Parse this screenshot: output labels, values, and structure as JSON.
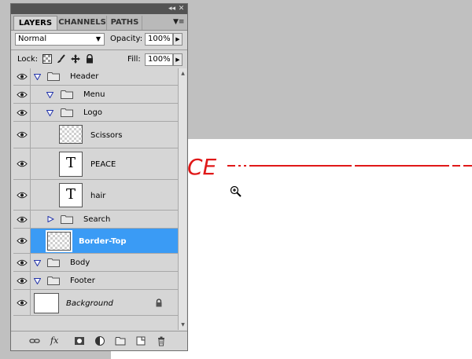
{
  "tabs": [
    {
      "label": "LAYERS",
      "active": true
    },
    {
      "label": "CHANNELS",
      "active": false
    },
    {
      "label": "PATHS",
      "active": false
    }
  ],
  "blend_mode": "Normal",
  "opacity": {
    "label": "Opacity:",
    "value": "100%"
  },
  "lock": {
    "label": "Lock:"
  },
  "fill": {
    "label": "Fill:",
    "value": "100%"
  },
  "layers": [
    {
      "name": "Header",
      "kind": "group",
      "expanded": true
    },
    {
      "name": "Menu",
      "kind": "group",
      "expanded": true
    },
    {
      "name": "Logo",
      "kind": "group",
      "expanded": true
    },
    {
      "name": "Scissors",
      "kind": "pixel"
    },
    {
      "name": "PEACE",
      "kind": "text"
    },
    {
      "name": "hair",
      "kind": "text"
    },
    {
      "name": "Search",
      "kind": "group",
      "expanded": false
    },
    {
      "name": "Border-Top",
      "kind": "pixel",
      "selected": true
    },
    {
      "name": "Body",
      "kind": "group",
      "expanded": true
    },
    {
      "name": "Footer",
      "kind": "group",
      "expanded": true
    },
    {
      "name": "Background",
      "kind": "background",
      "locked": true
    }
  ],
  "canvas": {
    "text": "CE",
    "text_color": "#e01818"
  },
  "colors": {
    "selection": "#3a9bf5",
    "panel_bg": "#d6d6d6",
    "workspace": "#c0c0c0"
  },
  "icons": {
    "bottom_bar": [
      "link-layers-icon",
      "fx-icon",
      "add-mask-icon",
      "adjustment-layer-icon",
      "new-group-icon",
      "new-layer-icon",
      "trash-icon"
    ]
  }
}
